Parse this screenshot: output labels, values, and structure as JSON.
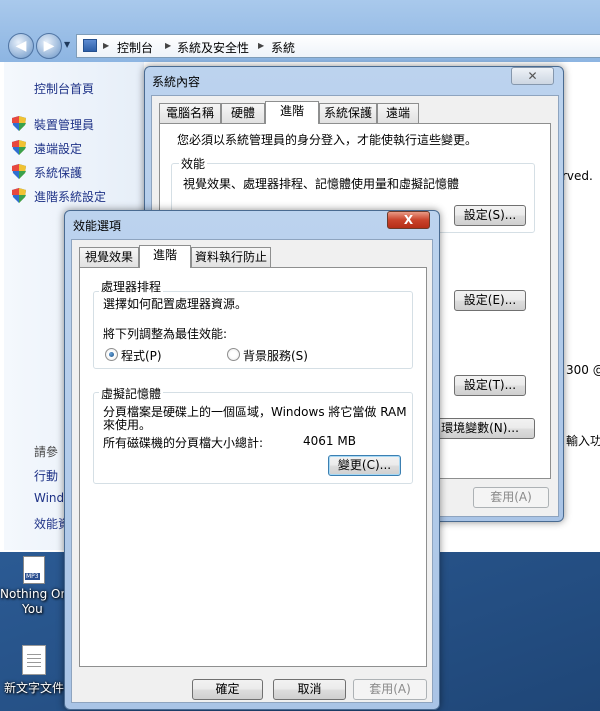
{
  "explorer": {
    "breadcrumbs": [
      "控制台",
      "系統及安全性",
      "系統"
    ],
    "left_links": [
      "控制台首頁",
      "裝置管理員",
      "遠端設定",
      "系統保護",
      "進階系統設定"
    ],
    "see_also": [
      "請參",
      "行動",
      "Wind",
      "效能資"
    ],
    "background_fragments": [
      "rved.",
      "300 @",
      "輸入功"
    ]
  },
  "desktop": {
    "icons": [
      {
        "label_line1": "Nothing On",
        "label_line2": "You",
        "tag": "MP3"
      },
      {
        "label_line1": "新文字文件"
      }
    ]
  },
  "system_properties": {
    "title": "系統內容",
    "tabs": [
      "電腦名稱",
      "硬體",
      "進階",
      "系統保護",
      "遠端"
    ],
    "active_tab": "進階",
    "admin_notice": "您必須以系統管理員的身分登入，才能使執行這些變更。",
    "performance_group": "效能",
    "performance_desc": "視覺效果、處理器排程、記憶體使用量和虛擬記憶體",
    "settings_s": "設定(S)...",
    "settings_e": "設定(E)...",
    "settings_t": "設定(T)...",
    "env_vars": "環境變數(N)...",
    "apply": "套用(A)"
  },
  "performance_options": {
    "title": "效能選項",
    "close": "X",
    "tabs": [
      "視覺效果",
      "進階",
      "資料執行防止"
    ],
    "active_tab": "進階",
    "scheduling_group": "處理器排程",
    "scheduling_desc": "選擇如何配置處理器資源。",
    "adjust_label": "將下列調整為最佳效能:",
    "radio_programs": "程式(P)",
    "radio_background": "背景服務(S)",
    "selected_option": "程式(P)",
    "vm_group": "虛擬記憶體",
    "vm_desc_line1": "分頁檔案是硬碟上的一個區域，Windows 將它當做 RAM",
    "vm_desc_line2": "來使用。",
    "total_label": "所有磁碟機的分頁檔大小總計:",
    "total_value": "4061 MB",
    "change": "變更(C)...",
    "ok": "確定",
    "cancel": "取消",
    "apply": "套用(A)"
  }
}
